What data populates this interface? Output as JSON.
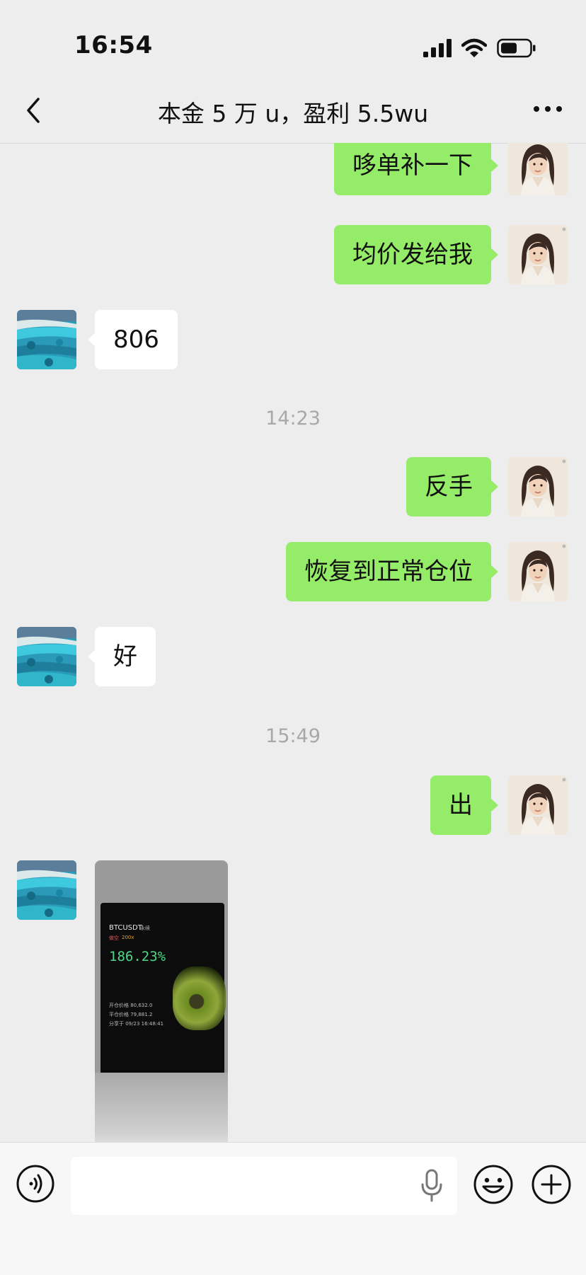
{
  "status_bar": {
    "time": "16:54",
    "icons": [
      "signal-icon",
      "wifi-icon",
      "battery-icon"
    ]
  },
  "header": {
    "title": "本金 5 万 u，盈利 5.5wu",
    "back_icon": "chevron-left-icon",
    "more_icon": "more-icon"
  },
  "messages": [
    {
      "sender": "self",
      "text": "哆单补一下"
    },
    {
      "sender": "self",
      "text": "均价发给我"
    },
    {
      "sender": "other",
      "text": "806"
    },
    {
      "type": "timestamp",
      "text": "14:23"
    },
    {
      "sender": "self",
      "text": "反手"
    },
    {
      "sender": "self",
      "text": "恢复到正常仓位"
    },
    {
      "sender": "other",
      "text": "好"
    },
    {
      "type": "timestamp",
      "text": "15:49"
    },
    {
      "sender": "self",
      "text": "出"
    },
    {
      "sender": "other",
      "type": "image",
      "image": {
        "ticker": "BTCUSDT",
        "tag": "永续",
        "side": "做空",
        "leverage": "200x",
        "pnl": "186.23%",
        "details": [
          "开仓价格 80,632.0",
          "平仓价格 79,881.2",
          "分享于 09/23 16:48:41"
        ]
      }
    }
  ],
  "input_bar": {
    "placeholder": "",
    "voice_icon": "voice-icon",
    "mic_icon": "mic-icon",
    "emoji_icon": "emoji-icon",
    "plus_icon": "plus-icon"
  },
  "colors": {
    "self_bubble": "#95ec69",
    "other_bubble": "#ffffff",
    "background": "#ededed",
    "timestamp": "#a8a8a8"
  }
}
